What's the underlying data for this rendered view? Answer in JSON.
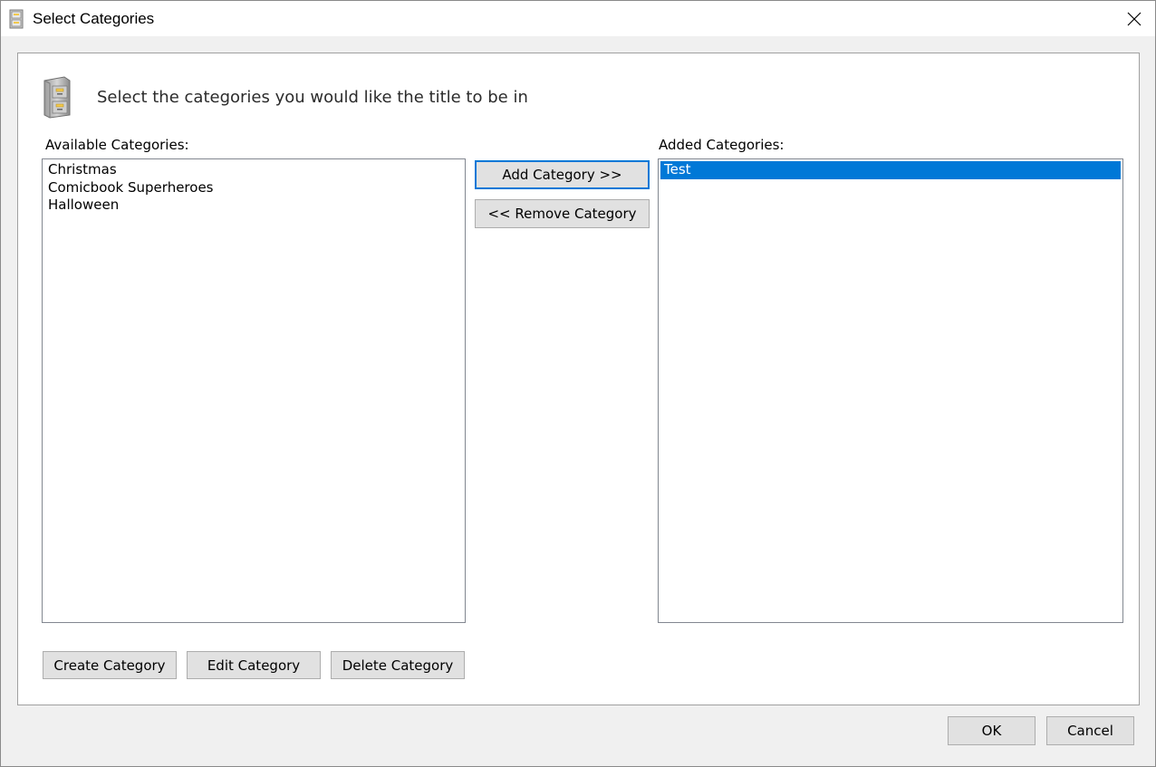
{
  "window": {
    "title": "Select Categories",
    "icon": "file-cabinet-icon",
    "close_icon": "close-icon"
  },
  "header": {
    "icon": "file-cabinet-icon",
    "text": "Select the categories you would like the title to be in"
  },
  "available": {
    "label": "Available Categories:",
    "items": [
      "Christmas",
      "Comicbook Superheroes",
      "Halloween"
    ]
  },
  "added": {
    "label": "Added Categories:",
    "items": [
      "Test"
    ],
    "selected_index": 0
  },
  "middle_buttons": {
    "add": "Add Category >>",
    "remove": "<< Remove Category"
  },
  "bottom_buttons": {
    "create": "Create Category",
    "edit": "Edit Category",
    "delete": "Delete Category"
  },
  "dialog_buttons": {
    "ok": "OK",
    "cancel": "Cancel"
  },
  "colors": {
    "selection": "#0078d7",
    "default_button_border": "#0078d7",
    "button_face": "#e1e1e1",
    "dialog_background": "#f0f0f0"
  }
}
